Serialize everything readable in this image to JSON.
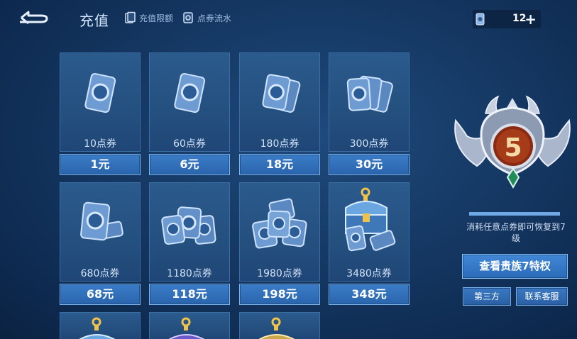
{
  "header": {
    "title": "充值",
    "links": [
      {
        "label": "充值限额",
        "icon": "card-limit-icon"
      },
      {
        "label": "点券流水",
        "icon": "ticket-log-icon"
      }
    ],
    "balance": {
      "icon": "coupon-icon",
      "value": "12",
      "add_label": "+"
    }
  },
  "packages": [
    {
      "qty": "10点券",
      "price": "1元"
    },
    {
      "qty": "60点券",
      "price": "6元"
    },
    {
      "qty": "180点券",
      "price": "18元"
    },
    {
      "qty": "300点券",
      "price": "30元"
    },
    {
      "qty": "680点券",
      "price": "68元"
    },
    {
      "qty": "1180点券",
      "price": "118元"
    },
    {
      "qty": "1980点券",
      "price": "198元"
    },
    {
      "qty": "3480点券",
      "price": "348元"
    }
  ],
  "vip": {
    "level": "5",
    "progress": 1.0,
    "hint": "消耗任意点券即可恢复到7级",
    "view_button": "查看贵族7特权",
    "third_party_button": "第三方",
    "service_button": "联系客服"
  },
  "colors": {
    "accent": "#2f6fbb",
    "background": "#163a66",
    "medal_red": "#8a2a12"
  }
}
